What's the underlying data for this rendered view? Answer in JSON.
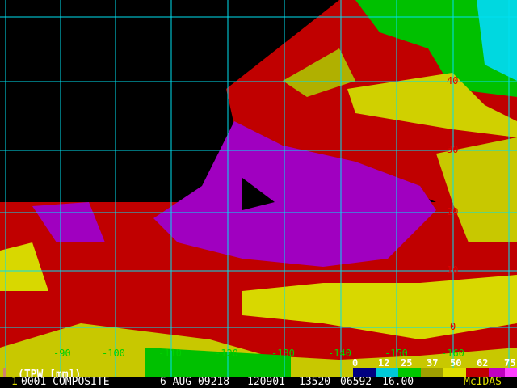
{
  "product": "(TPW [mm])",
  "status_bar": {
    "frame": "1",
    "area": "0001 COMPOSITE",
    "date": "6 AUG 09218",
    "time": "120901",
    "line": "13520",
    "element": "06592",
    "resolution": "16.00",
    "brand": "McIDAS"
  },
  "longitude_labels": [
    "-90",
    "-100",
    "-110",
    "-120",
    "-130",
    "-140",
    "-150",
    "-160"
  ],
  "latitude_labels": [
    "40",
    "30",
    "20",
    "10",
    "0"
  ],
  "colorbar": {
    "ticks": [
      "0",
      "12",
      "25",
      "37",
      "50",
      "62",
      "75"
    ],
    "colors": [
      "#000080",
      "#00c8d8",
      "#00c800",
      "#a0a000",
      "#e0e000",
      "#c00000",
      "#c000c0",
      "#ff40ff"
    ]
  }
}
